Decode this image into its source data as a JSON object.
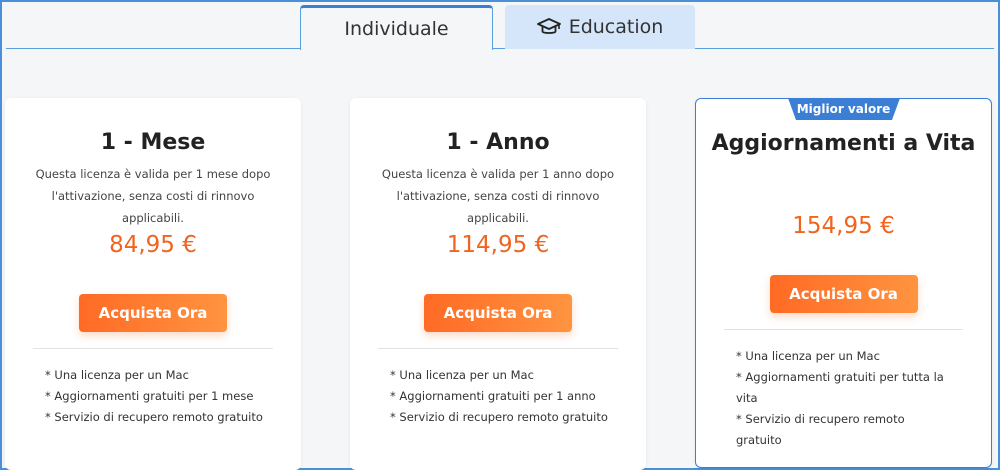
{
  "tabs": [
    {
      "label": "Individuale",
      "active": true
    },
    {
      "label": "Education",
      "icon": "graduation-cap-icon",
      "active": false
    }
  ],
  "plans": [
    {
      "title": "1 - Mese",
      "desc_line1": "Questa licenza è valida per 1 mese dopo",
      "desc_line2": "l'attivazione, senza costi di rinnovo applicabili.",
      "price": "84,95 €",
      "button": "Acquista Ora",
      "features": [
        "* Una licenza per un Mac",
        "* Aggiornamenti gratuiti per 1 mese",
        "* Servizio di recupero remoto gratuito"
      ]
    },
    {
      "title": "1 - Anno",
      "desc_line1": "Questa licenza è valida per 1 anno dopo",
      "desc_line2": "l'attivazione, senza costi di rinnovo applicabili.",
      "price": "114,95 €",
      "button": "Acquista Ora",
      "features": [
        "* Una licenza per un Mac",
        "* Aggiornamenti gratuiti per 1 anno",
        "* Servizio di recupero remoto gratuito"
      ]
    },
    {
      "badge": "Miglior valore",
      "title": "Aggiornamenti a Vita",
      "price": "154,95 €",
      "button": "Acquista Ora",
      "features": [
        "* Una licenza per un Mac",
        "* Aggiornamenti gratuiti per tutta la",
        "vita",
        "* Servizio di recupero remoto gratuito"
      ]
    }
  ],
  "colors": {
    "accent_blue": "#3a7fd5",
    "price_orange": "#f0641e",
    "button_gradient_start": "#ff6a25",
    "button_gradient_end": "#ff9440",
    "education_tab_bg": "#d5e6fb"
  }
}
